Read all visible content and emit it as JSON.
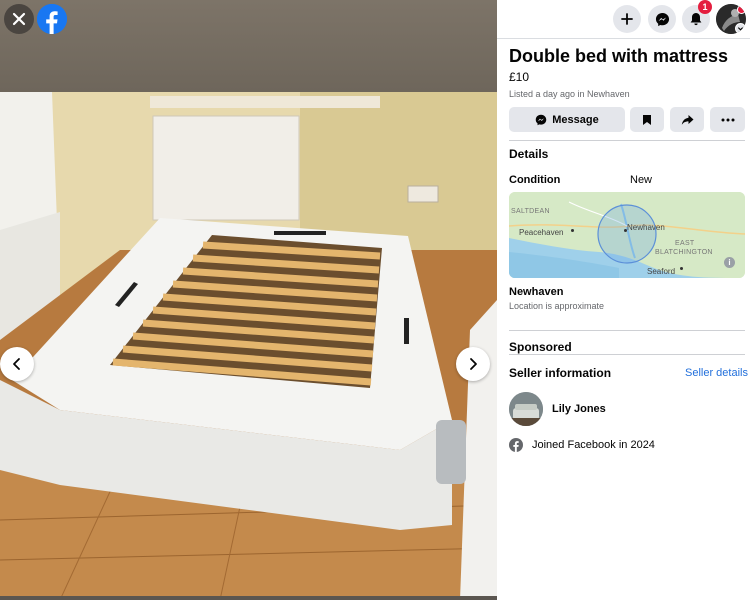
{
  "viewer": {
    "close_icon": "close-icon",
    "logo_icon": "facebook-logo-icon",
    "prev_icon": "chevron-left-icon",
    "next_icon": "chevron-right-icon",
    "brand_color": "#1877f2"
  },
  "topbar": {
    "create_icon": "plus-icon",
    "messenger_icon": "messenger-icon",
    "notifications_icon": "bell-icon",
    "notification_count": "1",
    "account_icon": "avatar-icon"
  },
  "listing": {
    "title": "Double bed with mattress",
    "price": "£10",
    "listed": "Listed a day ago in Newhaven"
  },
  "actions": {
    "message_label": "Message",
    "save_icon": "bookmark-icon",
    "share_icon": "share-icon",
    "more_icon": "more-icon"
  },
  "details": {
    "heading": "Details",
    "condition_label": "Condition",
    "condition_value": "New"
  },
  "map": {
    "labels": {
      "saltdean": "SALTDEAN",
      "peacehaven": "Peacehaven",
      "newhaven": "Newhaven",
      "east": "EAST",
      "blatchington": "BLATCHINGTON",
      "seaford": "Seaford"
    },
    "info_icon": "info-icon"
  },
  "location": {
    "name": "Newhaven",
    "note": "Location is approximate"
  },
  "sponsored": {
    "heading": "Sponsored"
  },
  "seller": {
    "heading": "Seller information",
    "details_link": "Seller details",
    "name": "Lily Jones",
    "joined": "Joined Facebook in 2024",
    "link_color": "#216fdb"
  }
}
